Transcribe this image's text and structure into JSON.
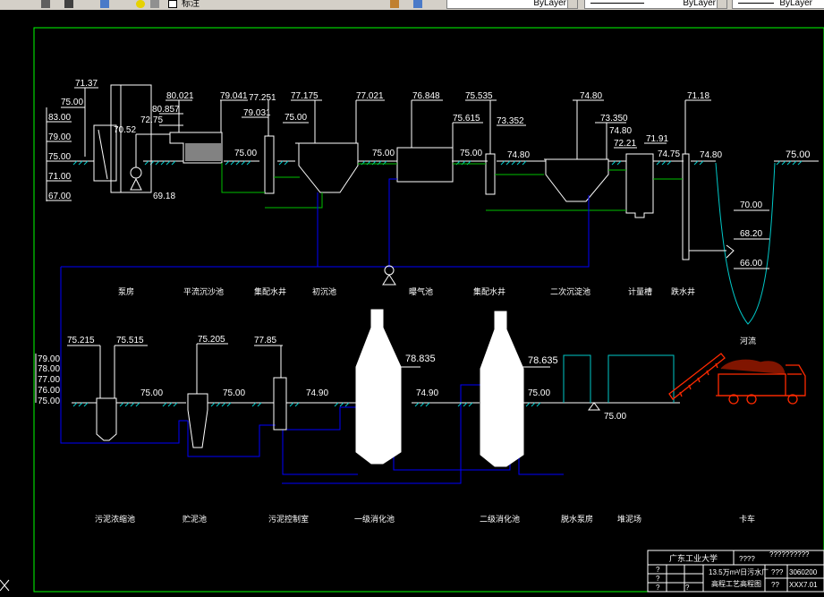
{
  "toolbar": {
    "layer_name": "标注",
    "linetype_value": "ByLayer",
    "lineweight_value": "ByLayer",
    "color_value": "ByLayer"
  },
  "colors": {
    "background": "#000000",
    "frame": "#00ff00",
    "white": "#ffffff",
    "blue_pipe": "#0000ff",
    "green_pipe": "#00c000",
    "truck_red": "#ff2a00",
    "cyan": "#00c8c8",
    "sand": "#c8c8c8"
  },
  "levels_row1": {
    "left_scale": [
      "83.00",
      "79.00",
      "75.00",
      "71.00",
      "67.00"
    ],
    "pump": [
      "71.37",
      "75.00",
      "70.52",
      "69.18"
    ],
    "grit": [
      "80.021",
      "80.857",
      "72.75"
    ],
    "distribution_well": [
      "79.041",
      "77.251",
      "79.031"
    ],
    "primary": [
      "77.175",
      "75.00",
      "75.00"
    ],
    "aeration": [
      "77.021",
      "75.00",
      "76.848"
    ],
    "distribution_well_2": [
      "75.535",
      "75.615",
      "75.00",
      "73.352"
    ],
    "secondary": [
      "74.80",
      "74.80",
      "73.350",
      "74.80"
    ],
    "meter": [
      "72.21",
      "71.91",
      "74.75"
    ],
    "outfall": [
      "71.18",
      "74.80",
      "75.00",
      "70.00",
      "68.20",
      "66.00"
    ]
  },
  "labels_row1": {
    "pump_house": "泵房",
    "grit_chamber": "平流沉沙池",
    "distribution_well": "集配水井",
    "primary_clarifier": "初沉池",
    "aeration_tank": "曝气池",
    "distribution_well_2": "集配水井",
    "secondary_clarifier": "二次沉淀池",
    "metering_flume": "计量槽",
    "outfall_well": "跌水井",
    "river": "河流"
  },
  "levels_row2": {
    "left_scale": [
      "79.00",
      "78.00",
      "77.00",
      "76.00",
      "75.00"
    ],
    "thickener": [
      "75.215",
      "75.515",
      "75.00"
    ],
    "storage": [
      "75.205",
      "75.00"
    ],
    "control_room": [
      "77.85",
      "74.90"
    ],
    "digester1": [
      "78.835",
      "74.90"
    ],
    "digester2": [
      "78.635",
      "75.00"
    ],
    "pump": [
      "75.00"
    ]
  },
  "labels_row2": {
    "thickener": "污泥浓缩池",
    "storage": "贮泥池",
    "control_room": "污泥控制室",
    "digester1": "一级消化池",
    "digester2": "二级消化池",
    "dewatering": "脱水泵房",
    "cake_yard": "堆泥场",
    "truck": "卡车"
  },
  "title_block": {
    "school": "广东工业大学",
    "project": "13.5万m³/日污水厂",
    "drawing_title": "高程工艺高程图",
    "row_marks": [
      "?",
      "?",
      "?",
      "?"
    ],
    "right_codes": [
      "??????????",
      "????",
      "???",
      "??",
      "3060200",
      "XXX7.01"
    ]
  }
}
